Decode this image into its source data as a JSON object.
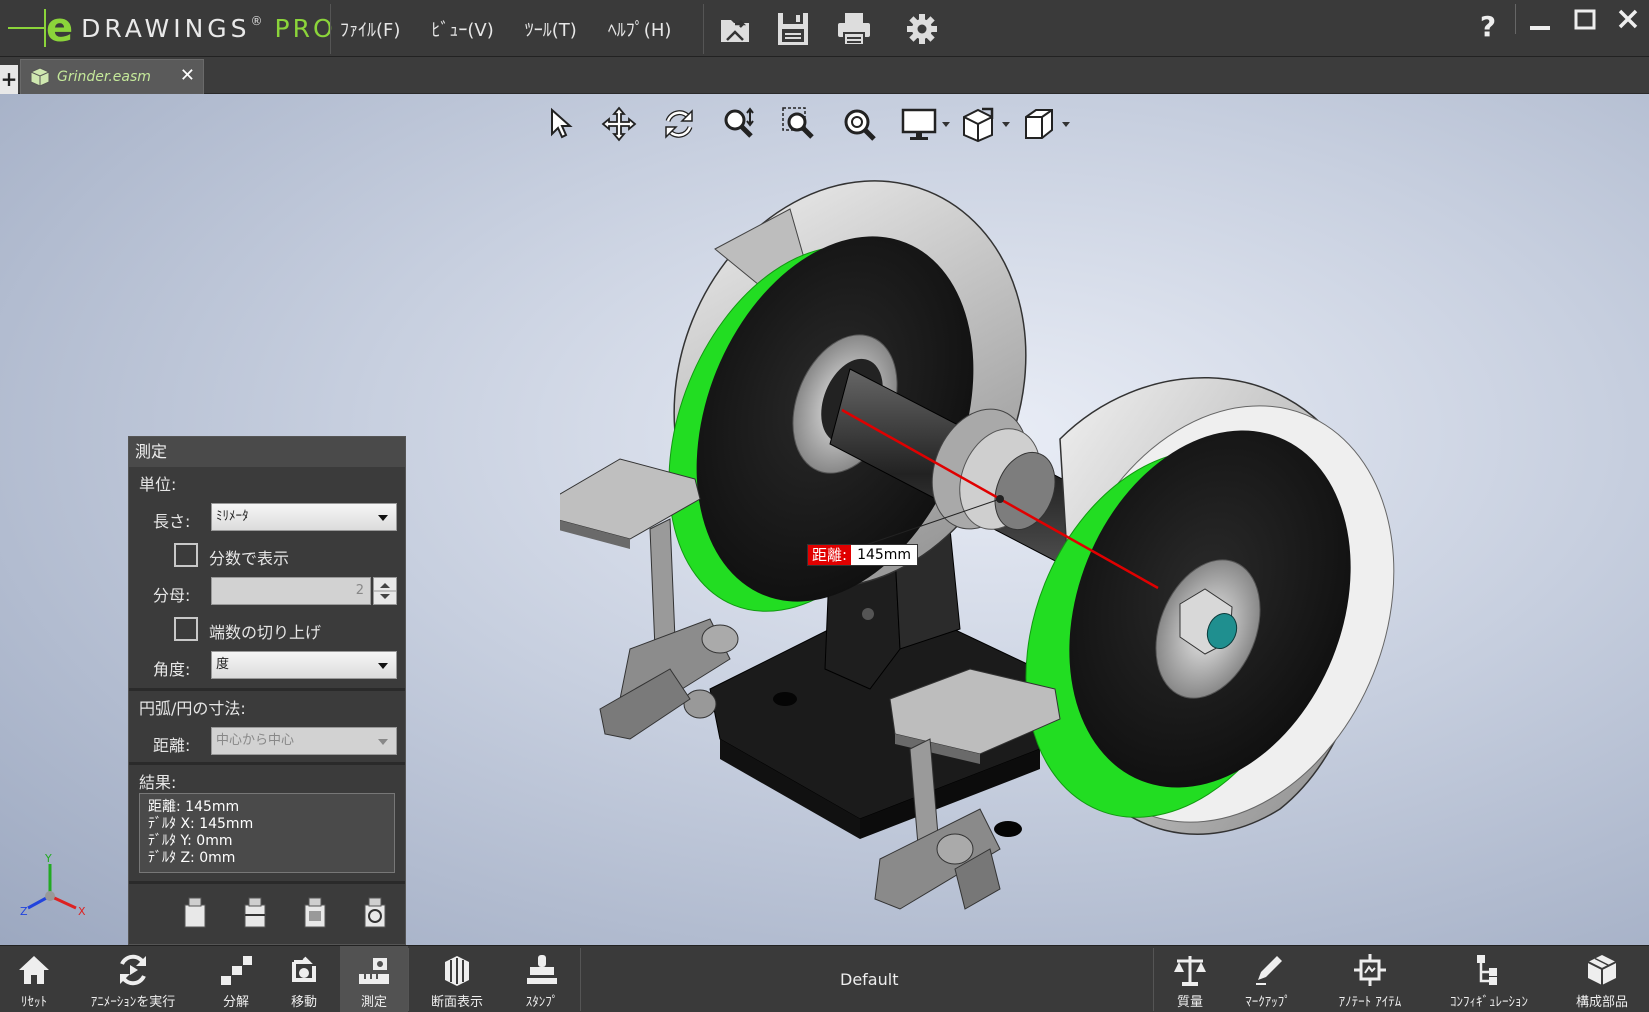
{
  "app": {
    "logo_e": "e",
    "logo_name": "DRAWINGS",
    "logo_reg": "®",
    "logo_pro": "PRO"
  },
  "menu": [
    "ﾌｧｲﾙ(F)",
    "ﾋﾞｭｰ(V)",
    "ﾂｰﾙ(T)",
    "ﾍﾙﾌﾟ(H)"
  ],
  "toolbar_icons": [
    "open-icon",
    "save-icon",
    "print-icon",
    "settings-icon"
  ],
  "window": {
    "help": "?"
  },
  "tab": {
    "add": "+",
    "name": "Grinder.easm",
    "close": "✕"
  },
  "view_tools": [
    "select-arrow-icon",
    "pan-icon",
    "rotate-icon",
    "zoom-fit-icon",
    "zoom-area-icon",
    "zoom-icon",
    "display-style-icon",
    "view-orientation-icon",
    "view-cube-icon"
  ],
  "measurement": {
    "key": "距離:",
    "value": "145mm"
  },
  "triad": {
    "y": "Y",
    "z": "Z",
    "x": "X"
  },
  "measure_panel": {
    "title": "測定",
    "units_section": "単位:",
    "length_label": "長さ:",
    "length_value": "ﾐﾘﾒｰﾀ",
    "fraction_label": "分数で表示",
    "denominator_label": "分母:",
    "denominator_value": "2",
    "round_label": "端数の切り上げ",
    "angle_label": "角度:",
    "angle_value": "度",
    "arc_section": "円弧/円の寸法:",
    "distance_label": "距離:",
    "distance_value": "中心から中心",
    "results_section": "結果:",
    "results": [
      "距離: 145mm",
      " ﾃﾞﾙﾀ X: 145mm",
      " ﾃﾞﾙﾀ Y: 0mm",
      " ﾃﾞﾙﾀ Z: 0mm"
    ]
  },
  "bottom_left": [
    {
      "label": "ﾘｾｯﾄ",
      "icon": "home-icon"
    },
    {
      "label": "ｱﾆﾒｰｼｮﾝを実行",
      "icon": "animation-icon"
    },
    {
      "label": "分解",
      "icon": "explode-icon"
    },
    {
      "label": "移動",
      "icon": "move-icon"
    },
    {
      "label": "測定",
      "icon": "measure-icon"
    },
    {
      "label": "断面表示",
      "icon": "section-icon"
    },
    {
      "label": "ｽﾀﾝﾌﾟ",
      "icon": "stamp-icon"
    }
  ],
  "configuration": "Default",
  "bottom_right": [
    {
      "label": "質量",
      "icon": "mass-icon"
    },
    {
      "label": "ﾏｰｸｱｯﾌﾟ",
      "icon": "markup-icon"
    },
    {
      "label": "ｱﾉﾃｰﾄ ｱｲﾃﾑ",
      "icon": "annotation-icon"
    },
    {
      "label": "ｺﾝﾌｨｷﾞｭﾚｰｼｮﾝ",
      "icon": "configuration-icon"
    },
    {
      "label": "構成部品",
      "icon": "components-icon"
    }
  ],
  "colors": {
    "accent_green": "#8bd43a",
    "highlight_green": "#22dd22",
    "measure_red": "#e00000"
  }
}
